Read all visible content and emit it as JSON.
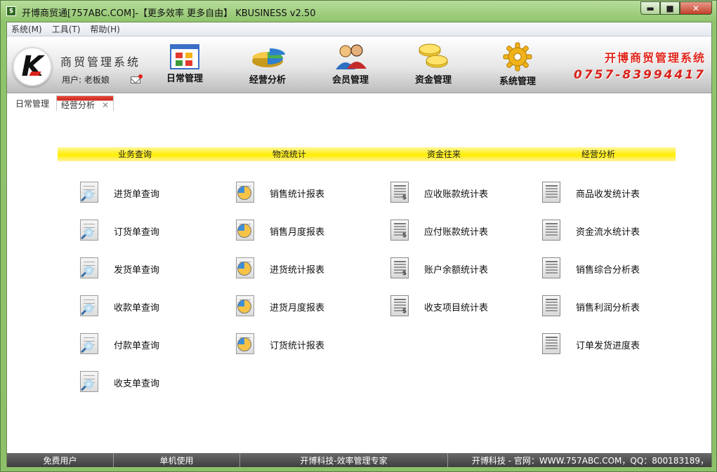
{
  "window": {
    "app_icon": "$",
    "title": "开博商贸通[757ABC.COM]-【更多效率 更多自由】 KBUSINESS v2.50",
    "minimize": "▬",
    "maximize": "■",
    "close": "✕"
  },
  "menu": [
    "系统(M)",
    "工具(T)",
    "帮助(H)"
  ],
  "banner": {
    "logo_letter": "K",
    "system_name": "商贸管理系统",
    "user_label": "用户: 老板娘",
    "nav": [
      {
        "label": "日常管理",
        "icon": "calendar-grid-icon"
      },
      {
        "label": "经营分析",
        "icon": "pie-chart-icon"
      },
      {
        "label": "会员管理",
        "icon": "members-icon"
      },
      {
        "label": "资金管理",
        "icon": "coins-icon"
      },
      {
        "label": "系统管理",
        "icon": "gear-icon"
      }
    ],
    "brand_title": "开博商贸管理系统",
    "brand_phone": "0757-83994417"
  },
  "tabs": [
    {
      "label": "日常管理",
      "active": false
    },
    {
      "label": "经营分析",
      "active": true,
      "close": "✕"
    }
  ],
  "sections": {
    "headers": [
      "业务查询",
      "物流统计",
      "资金往来",
      "经营分析"
    ],
    "business_query": [
      "进货单查询",
      "订货单查询",
      "发货单查询",
      "收款单查询",
      "付款单查询",
      "收支单查询"
    ],
    "logistics": [
      "销售统计报表",
      "销售月度报表",
      "进货统计报表",
      "进货月度报表",
      "订货统计报表"
    ],
    "funds": [
      "应收账款统计表",
      "应付账款统计表",
      "账户余额统计表",
      "收支项目统计表"
    ],
    "analysis": [
      "商品收发统计表",
      "资金流水统计表",
      "销售综合分析表",
      "销售利润分析表",
      "订单发货进度表"
    ]
  },
  "statusbar": {
    "user_type": "免费用户",
    "mode": "单机使用",
    "slogan": "开博科技-效率管理专家",
    "site": "开博科技 - 官网：WWW.757ABC.COM，QQ：800183189，"
  },
  "colors": {
    "header_yellow": "#ffed00",
    "brand_red": "#e0251b",
    "frame_green": "#8fc46d"
  }
}
